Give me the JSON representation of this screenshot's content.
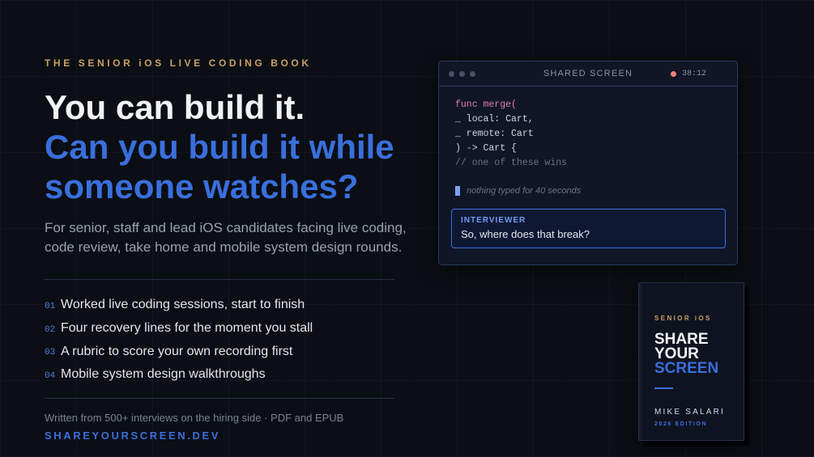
{
  "eyebrow": "THE SENIOR iOS LIVE CODING BOOK",
  "headline": {
    "line1": "You can build it.",
    "line2": "Can you build it while someone watches?"
  },
  "subtext": "For senior, staff and lead iOS candidates facing live coding, code review, take home and mobile system design rounds.",
  "features": [
    {
      "num": "01",
      "text": "Worked live coding sessions, start to finish"
    },
    {
      "num": "02",
      "text": "Four recovery lines for the moment you stall"
    },
    {
      "num": "03",
      "text": "A rubric to score your own recording first"
    },
    {
      "num": "04",
      "text": "Mobile system design walkthroughs"
    }
  ],
  "footnote": "Written from 500+ interviews on the hiring side · PDF and EPUB",
  "site": "SHAREYOURSCREEN.DEV",
  "window": {
    "title": "SHARED SCREEN",
    "timer": "38:12",
    "code": {
      "line1": "func merge(",
      "line2": "_ local: Cart,",
      "line3": "_ remote: Cart",
      "line4": ") -> Cart {",
      "line5": "// one of these wins"
    },
    "idle_status": "nothing typed for 40 seconds",
    "chat": {
      "label": "INTERVIEWER",
      "message": "So, where does that break?"
    }
  },
  "book": {
    "tag": "SENIOR iOS",
    "title_words": [
      "SHARE",
      "YOUR",
      "SCREEN"
    ],
    "author": "MIKE SALARI",
    "edition": "2026 EDITION"
  },
  "colors": {
    "background": "#0b0e14",
    "accent_blue": "#3a6fdc",
    "accent_gold": "#c9a164",
    "record_red": "#f08080"
  }
}
